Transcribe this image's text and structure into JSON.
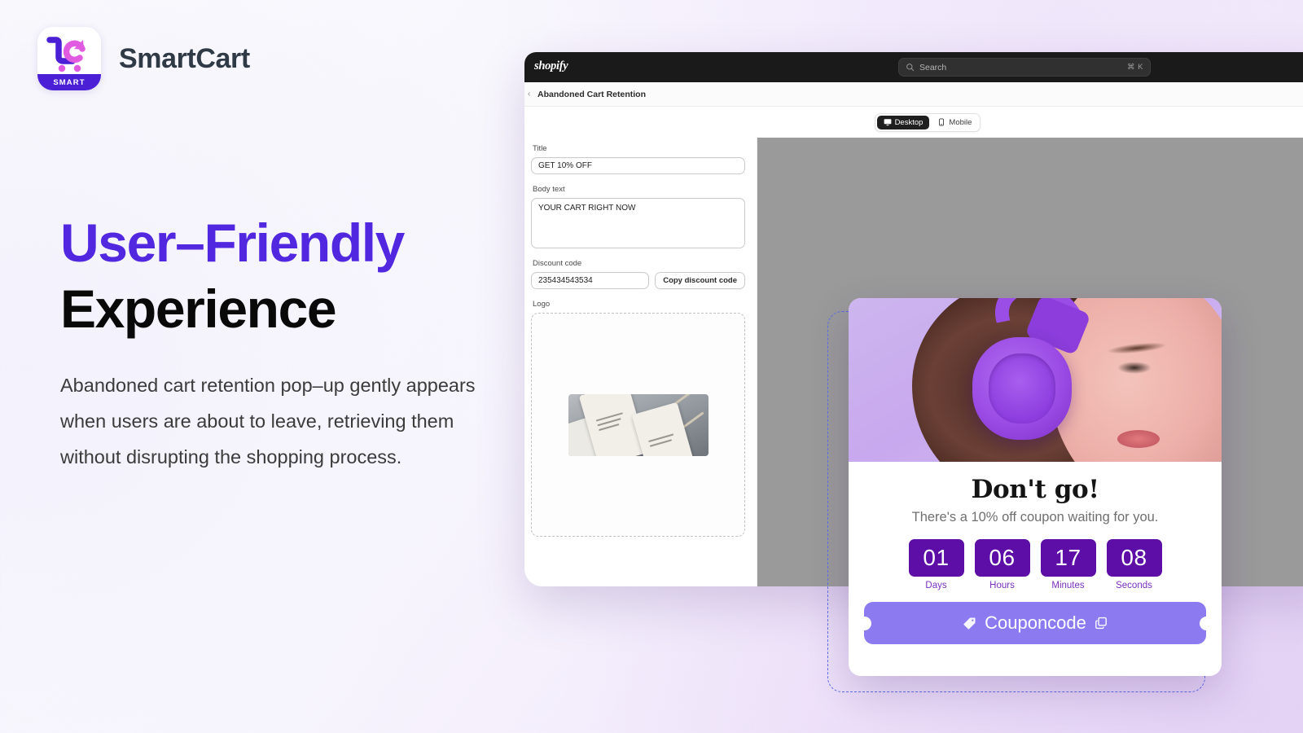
{
  "brand": {
    "name": "SmartCart",
    "logo_badge": "SMART",
    "logo_icon": "shopping-cart-refresh-icon",
    "accent_purple": "#5227e0",
    "accent_magenta": "#e05be0"
  },
  "hero": {
    "headline_line1": "User–Friendly",
    "headline_line2": "Experience",
    "body": "Abandoned cart retention pop–up gently appears when users are about to leave, retrieving them without disrupting the shopping process."
  },
  "app": {
    "topbar": {
      "logo_text": "shopify",
      "search_placeholder": "Search",
      "search_shortcut": "⌘ K"
    },
    "breadcrumb": {
      "prev": "‹",
      "title": "Abandoned Cart Retention"
    },
    "device_toggle": {
      "options": [
        {
          "label": "Desktop",
          "icon": "monitor-icon",
          "active": true
        },
        {
          "label": "Mobile",
          "icon": "phone-icon",
          "active": false
        }
      ]
    },
    "form": {
      "title_label": "Title",
      "title_value": "GET 10% OFF",
      "body_label": "Body text",
      "body_value": "YOUR CART RIGHT NOW",
      "discount_label": "Discount code",
      "discount_value": "235434543534",
      "copy_button": "Copy discount code",
      "logo_label": "Logo",
      "logo_dropzone_image": "product-tags-photo"
    }
  },
  "popup": {
    "hero_image": "woman-wearing-purple-headphones",
    "title": "Don't go!",
    "subtitle": "There's a 10% off coupon waiting for you.",
    "countdown": [
      {
        "value": "01",
        "label": "Days"
      },
      {
        "value": "06",
        "label": "Hours"
      },
      {
        "value": "17",
        "label": "Minutes"
      },
      {
        "value": "08",
        "label": "Seconds"
      }
    ],
    "coupon_label": "Couponcode",
    "coupon_tag_icon": "tag-icon",
    "coupon_copy_icon": "copy-icon",
    "countdown_box_color": "#5c0ea6",
    "coupon_color": "#8c7af0"
  }
}
